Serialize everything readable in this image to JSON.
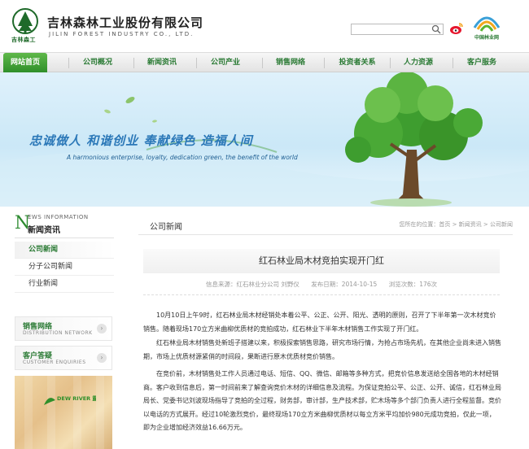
{
  "header": {
    "company_cn": "吉林森林工业股份有限公司",
    "company_en": "JILIN FOREST INDUSTRY CO., LTD.",
    "logo_caption": "吉林森工",
    "search_placeholder": "",
    "partner_logo_caption": "中国林业网"
  },
  "nav": {
    "items": [
      {
        "label": "网站首页",
        "active": true
      },
      {
        "label": "公司概况",
        "active": false
      },
      {
        "label": "新闻资讯",
        "active": false
      },
      {
        "label": "公司产业",
        "active": false
      },
      {
        "label": "销售网络",
        "active": false
      },
      {
        "label": "投资者关系",
        "active": false
      },
      {
        "label": "人力资源",
        "active": false
      },
      {
        "label": "客户服务",
        "active": false
      }
    ]
  },
  "banner": {
    "slogan_cn": "忠诚做人  和谐创业  奉献绿色  造福人间",
    "slogan_en": "A harmonious enterprise, loyalty, dedication green, the benefit of the world"
  },
  "sidebar": {
    "header_letter": "N",
    "header_en": "EWS INFORMATION",
    "header_cn": "新闻资讯",
    "items": [
      {
        "label": "公司新闻",
        "active": true
      },
      {
        "label": "分子公司新闻",
        "active": false
      },
      {
        "label": "行业新闻",
        "active": false
      }
    ],
    "boxes": [
      {
        "cn": "销售网络",
        "en": "DISTRIBUTION NETWORK"
      },
      {
        "cn": "客户答疑",
        "en": "CUSTOMER ENQUIRIES"
      }
    ],
    "wood_brand": "DEW RIVER 露水河"
  },
  "main": {
    "section_title": "公司新闻",
    "breadcrumb": "您所在的位置：首页 > 新闻资讯 > 公司新闻",
    "article_title": "红石林业局木材竞拍实现开门红",
    "meta_source": "信息来源：红石林业分公司 刘野仪",
    "meta_date": "发布日期：2014-10-15",
    "meta_views": "浏览次数：176次",
    "paragraphs": [
      "10月10日上午9时，红石林业局木材经销处本着公平、公正、公开、阳光、透明的原则，召开了下半年第一次木材竞价销售。随着现场170立方米曲柳优质材的竞拍成功，红石林业下半年木材销售工作实现了开门红。",
      "红石林业局木材销售处新班子搭建以来，积极探索销售思路，研究市场行情，为抢占市场先机，在其他企业尚未进入销售期，市场上优质材源紧俏的时间段，果断进行原木优质材竞价销售。",
      "在竞价前，木材销售处工作人员通过电话、短信、QQ、微信、邮箱等多种方式，把竞价信息发送给全国各地的木材经销商。客户收到信息后，第一时间前来了解查询竞价木材的详细信息及流程。为保证竞拍公平、公正、公开、诚信，红石林业局局长、党委书记刘波现场指导了竞拍的全过程，财务部，审计部，生产技术部，贮木场等多个部门负责人进行全程监督。竞价以电话的方式展开。经过10轮激烈竞价，最终现场170立方米曲柳优质材以每立方米平均加价980元成功竞拍，仅此一项，即为企业增加经济效益16.66万元。"
    ]
  },
  "colors": {
    "brand_green": "#2a7a34",
    "nav_active": "#3e9e32",
    "slogan_blue": "#2b78b8"
  }
}
